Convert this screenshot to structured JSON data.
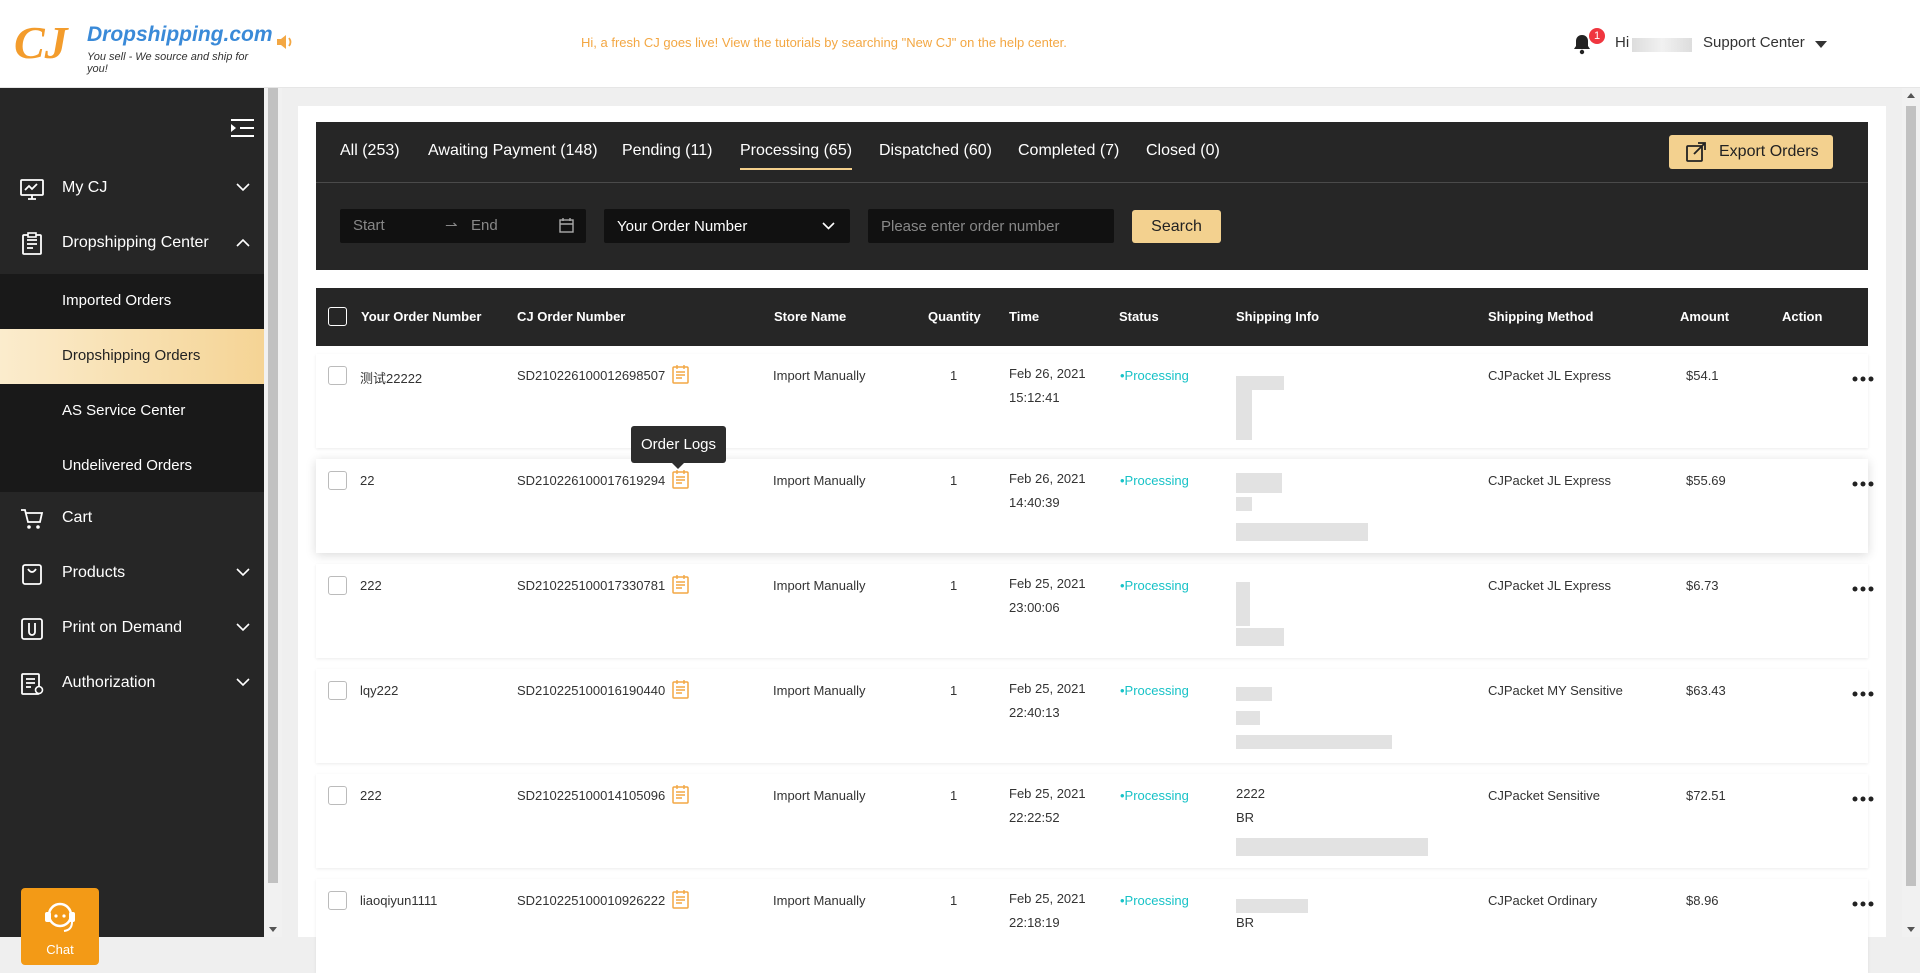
{
  "header": {
    "logo": {
      "mark": "CJ",
      "name": "Dropshipping.com",
      "tagline": "You sell - We source and ship for you!"
    },
    "notice": "Hi, a fresh CJ goes live! View the tutorials by searching \"New CJ\" on the help center.",
    "notifications_count": "1",
    "greeting": "Hi",
    "support_label": "Support Center"
  },
  "sidebar": {
    "items": [
      {
        "label": "My CJ",
        "icon": "monitor-chart-icon",
        "expanded": false
      },
      {
        "label": "Dropshipping Center",
        "icon": "clipboard-list-icon",
        "expanded": true
      },
      {
        "label": "Cart",
        "icon": "cart-icon"
      },
      {
        "label": "Products",
        "icon": "bag-icon",
        "expanded": false
      },
      {
        "label": "Print on Demand",
        "icon": "print-icon",
        "expanded": false
      },
      {
        "label": "Authorization",
        "icon": "document-icon",
        "expanded": false
      }
    ],
    "subitems": [
      {
        "label": "Imported Orders"
      },
      {
        "label": "Dropshipping Orders",
        "active": true
      },
      {
        "label": "AS Service Center"
      },
      {
        "label": "Undelivered Orders"
      }
    ],
    "chat_label": "Chat"
  },
  "tabs": [
    {
      "label": "All (253)"
    },
    {
      "label": "Awaiting Payment (148)"
    },
    {
      "label": "Pending (11)"
    },
    {
      "label": "Processing (65)",
      "active": true
    },
    {
      "label": "Dispatched (60)"
    },
    {
      "label": "Completed (7)"
    },
    {
      "label": "Closed (0)"
    }
  ],
  "export_label": "Export Orders",
  "filters": {
    "start_placeholder": "Start",
    "end_placeholder": "End",
    "date_separator": "⇀",
    "select_value": "Your Order Number",
    "order_placeholder": "Please enter order number",
    "search_label": "Search"
  },
  "table": {
    "columns": [
      "Your Order Number",
      "CJ Order Number",
      "Store Name",
      "Quantity",
      "Time",
      "Status",
      "Shipping Info",
      "Shipping Method",
      "Amount",
      "Action"
    ],
    "rows": [
      {
        "your_order": "测试22222",
        "cj_order": "SD210226100012698507",
        "store": "Import Manually",
        "qty": "1",
        "date": "Feb 26, 2021",
        "clock": "15:12:41",
        "status": "•Processing",
        "ship_line1": "",
        "ship_line2": "",
        "method": "CJPacket JL Express",
        "amount": "$54.1"
      },
      {
        "your_order": "22",
        "cj_order": "SD210226100017619294",
        "store": "Import Manually",
        "qty": "1",
        "date": "Feb 26, 2021",
        "clock": "14:40:39",
        "status": "•Processing",
        "ship_line1": "",
        "ship_line2": "",
        "method": "CJPacket JL Express",
        "amount": "$55.69"
      },
      {
        "your_order": "222",
        "cj_order": "SD210225100017330781",
        "store": "Import Manually",
        "qty": "1",
        "date": "Feb 25, 2021",
        "clock": "23:00:06",
        "status": "•Processing",
        "ship_line1": "",
        "ship_line2": "",
        "method": "CJPacket JL Express",
        "amount": "$6.73"
      },
      {
        "your_order": "lqy222",
        "cj_order": "SD210225100016190440",
        "store": "Import Manually",
        "qty": "1",
        "date": "Feb 25, 2021",
        "clock": "22:40:13",
        "status": "•Processing",
        "ship_line1": "",
        "ship_line2": "",
        "method": "CJPacket MY Sensitive",
        "amount": "$63.43"
      },
      {
        "your_order": "222",
        "cj_order": "SD210225100014105096",
        "store": "Import Manually",
        "qty": "1",
        "date": "Feb 25, 2021",
        "clock": "22:22:52",
        "status": "•Processing",
        "ship_line1": "2222",
        "ship_line2": "BR",
        "method": "CJPacket Sensitive",
        "amount": "$72.51"
      },
      {
        "your_order": "liaoqiyun1111",
        "cj_order": "SD210225100010926222",
        "store": "Import Manually",
        "qty": "1",
        "date": "Feb 25, 2021",
        "clock": "22:18:19",
        "status": "•Processing",
        "ship_line1": "",
        "ship_line2": "BR",
        "method": "CJPacket Ordinary",
        "amount": "$8.96"
      }
    ]
  },
  "tooltip": "Order Logs",
  "colors": {
    "accent": "#f3d18f",
    "dark": "#262626",
    "status": "#17c2c7",
    "brand_orange": "#f39c2c",
    "brand_blue": "#3a8ad8"
  }
}
